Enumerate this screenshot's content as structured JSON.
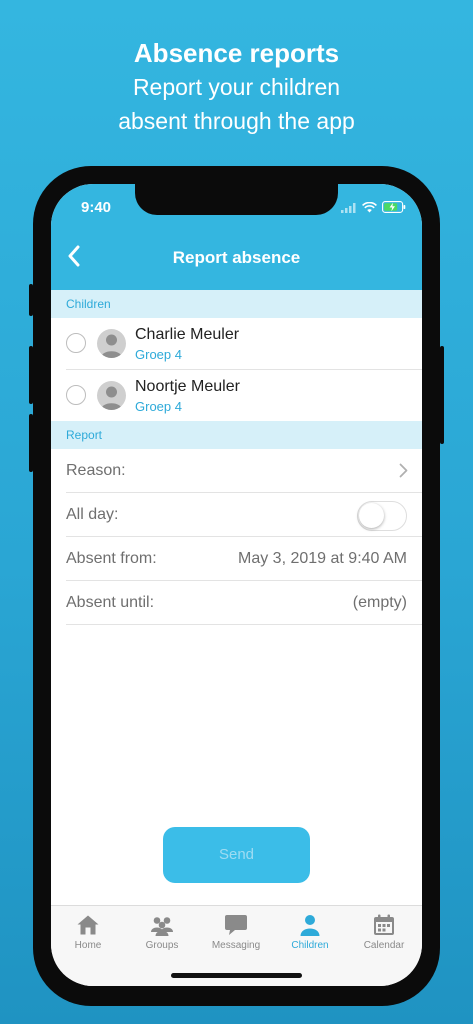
{
  "promo": {
    "title": "Absence reports",
    "line1": "Report your children",
    "line2": "absent through the app"
  },
  "status_bar": {
    "time": "9:40"
  },
  "nav": {
    "back_icon": "chevron-left-icon",
    "title": "Report absence"
  },
  "children_section": {
    "header": "Children",
    "items": [
      {
        "name": "Charlie Meuler",
        "group": "Groep 4"
      },
      {
        "name": "Noortje Meuler",
        "group": "Groep 4"
      }
    ]
  },
  "report_section": {
    "header": "Report",
    "reason_label": "Reason:",
    "all_day_label": "All day:",
    "all_day_on": false,
    "absent_from_label": "Absent from:",
    "absent_from_value": "May 3, 2019 at 9:40 AM",
    "absent_until_label": "Absent until:",
    "absent_until_value": "(empty)"
  },
  "send_label": "Send",
  "tabs": [
    {
      "label": "Home",
      "icon": "home-icon",
      "active": false
    },
    {
      "label": "Groups",
      "icon": "groups-icon",
      "active": false
    },
    {
      "label": "Messaging",
      "icon": "chat-bubble-icon",
      "active": false
    },
    {
      "label": "Children",
      "icon": "child-person-icon",
      "active": true
    },
    {
      "label": "Calendar",
      "icon": "calendar-icon",
      "active": false
    }
  ],
  "colors": {
    "accent": "#34b6e0",
    "section_bg": "#d6f0f9",
    "tab_active": "#2eaad9",
    "tab_inactive": "#8a8a8a"
  }
}
